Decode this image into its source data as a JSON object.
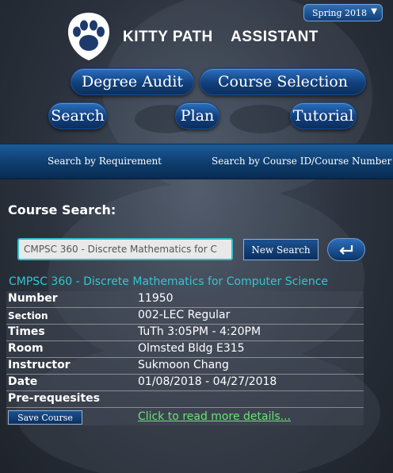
{
  "semester": {
    "selected": "Spring 2018",
    "caret": "▼"
  },
  "app": {
    "title": "KITTY PATH    ASSISTANT"
  },
  "nav": {
    "degree_audit": "Degree Audit",
    "course_selection": "Course Selection",
    "search": "Search",
    "plan": "Plan",
    "tutorial": "Tutorial"
  },
  "search_by": {
    "requirement": "Search by Requirement",
    "course_id": "Search by Course ID/Course Number"
  },
  "course_search": {
    "heading": "Course Search:",
    "input_value": "CMPSC 360 - Discrete Mathematics for C",
    "new_search_label": "New Search",
    "back_icon": "return-arrow-icon"
  },
  "course": {
    "title": "CMPSC 360 - Discrete Mathematics for Computer Science",
    "rows": [
      {
        "label": "Number",
        "value": "11950"
      },
      {
        "label": "Section",
        "value": "002-LEC Regular"
      },
      {
        "label": "Times",
        "value": "TuTh 3:05PM - 4:20PM"
      },
      {
        "label": "Room",
        "value": "Olmsted Bldg E315"
      },
      {
        "label": "Instructor",
        "value": "Sukmoon Chang"
      },
      {
        "label": "Date",
        "value": "01/08/2018 - 04/27/2018"
      },
      {
        "label": "Pre-requesites",
        "value": ""
      }
    ],
    "save_label": "Save Course",
    "more_link": "Click to read more details..."
  },
  "colors": {
    "accent_cyan": "#33c6cf",
    "link_green": "#6fe07a",
    "button_blue": "#123f7c"
  }
}
